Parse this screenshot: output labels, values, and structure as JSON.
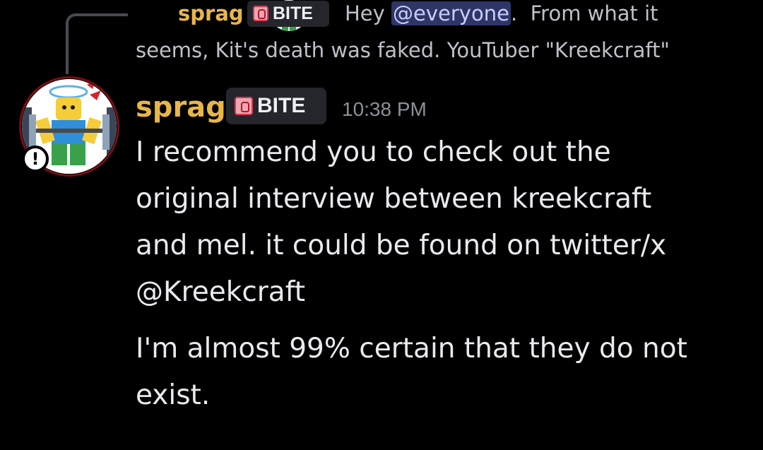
{
  "reply": {
    "author": "sprag",
    "tag_label": "BITE",
    "text_prefix": "Hey",
    "mention": "@everyone",
    "text_suffix": ".  From what it",
    "text_line2": "seems, Kit's death was faked. YouTuber \"Kreekcraft\""
  },
  "message": {
    "author": "sprag",
    "tag_label": "BITE",
    "timestamp": "10:38 PM",
    "paragraphs": [
      {
        "lines": [
          "I recommend you to check out the",
          "original interview between kreekcraft",
          "and mel. it could be found on twitter/x",
          "@Kreekcraft"
        ]
      },
      {
        "lines": [
          "I'm almost 99% certain that they do not",
          "exist."
        ]
      }
    ]
  },
  "avatar": {
    "icon": "roblox-noob-avatar-icon",
    "badge_icon": "alert-icon",
    "badge_text": "!"
  },
  "colors": {
    "background": "#000000",
    "author": "#e8b647",
    "body_text": "#e9e9ee",
    "timestamp": "#8e9099",
    "tag_background": "#25262b",
    "mention_background": "#2f3566",
    "mention_text": "#c9cdfb"
  }
}
